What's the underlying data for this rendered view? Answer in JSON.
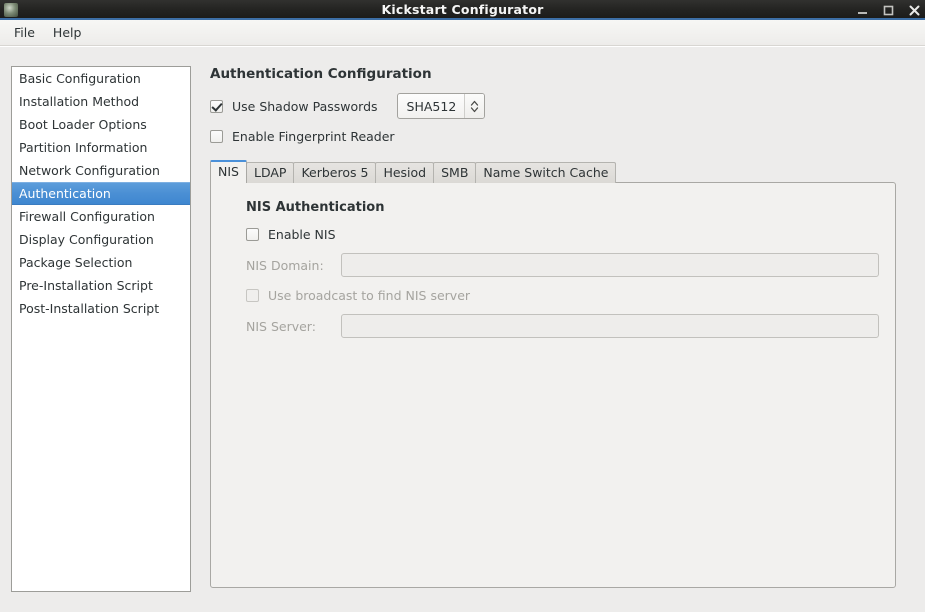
{
  "window": {
    "title": "Kickstart Configurator",
    "app_icon": "app-icon",
    "buttons": {
      "minimize": "minimize-icon",
      "maximize": "maximize-icon",
      "close": "close-icon"
    }
  },
  "menubar": {
    "items": [
      {
        "label": "File"
      },
      {
        "label": "Help"
      }
    ]
  },
  "sidebar": {
    "items": [
      {
        "label": "Basic Configuration",
        "selected": false
      },
      {
        "label": "Installation Method",
        "selected": false
      },
      {
        "label": "Boot Loader Options",
        "selected": false
      },
      {
        "label": "Partition Information",
        "selected": false
      },
      {
        "label": "Network Configuration",
        "selected": false
      },
      {
        "label": "Authentication",
        "selected": true
      },
      {
        "label": "Firewall Configuration",
        "selected": false
      },
      {
        "label": "Display Configuration",
        "selected": false
      },
      {
        "label": "Package Selection",
        "selected": false
      },
      {
        "label": "Pre-Installation Script",
        "selected": false
      },
      {
        "label": "Post-Installation Script",
        "selected": false
      }
    ],
    "selected_color": "#4a8fd4"
  },
  "main": {
    "title": "Authentication Configuration",
    "shadow_passwords": {
      "label": "Use Shadow Passwords",
      "checked": true,
      "algorithm_value": "SHA512",
      "algorithm_icon": "updown-chevron-icon"
    },
    "fingerprint": {
      "label": "Enable Fingerprint Reader",
      "checked": false
    },
    "tabs": [
      {
        "label": "NIS",
        "active": true
      },
      {
        "label": "LDAP",
        "active": false
      },
      {
        "label": "Kerberos 5",
        "active": false
      },
      {
        "label": "Hesiod",
        "active": false
      },
      {
        "label": "SMB",
        "active": false
      },
      {
        "label": "Name Switch Cache",
        "active": false
      }
    ],
    "nis_panel": {
      "heading": "NIS Authentication",
      "enable": {
        "label": "Enable NIS",
        "checked": false
      },
      "domain": {
        "label": "NIS Domain:",
        "value": "",
        "placeholder": "",
        "disabled": true
      },
      "broadcast": {
        "label": "Use broadcast to find NIS server",
        "checked": false,
        "disabled": true
      },
      "server": {
        "label": "NIS Server:",
        "value": "",
        "placeholder": "",
        "disabled": true
      }
    }
  },
  "theme": {
    "titlebar_bg": "#232321",
    "titlebar_accent": "#3c6ea5",
    "window_bg": "#edeceb",
    "panel_bg": "#f2f1ef",
    "tab_active_accent": "#4a90d9",
    "text": "#2e3436",
    "disabled_text": "#a5a49f"
  }
}
